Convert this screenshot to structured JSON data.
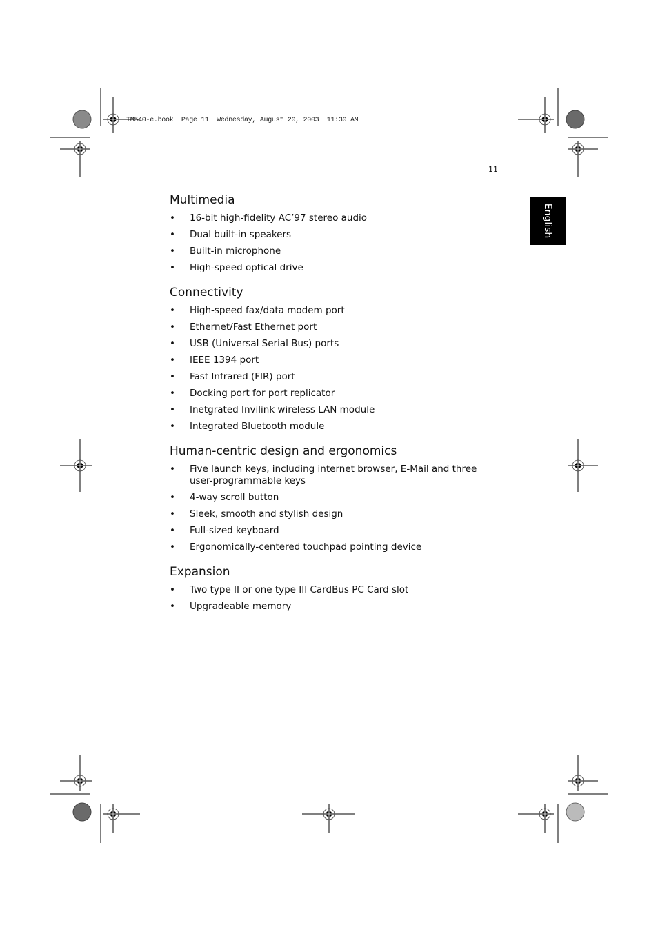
{
  "header": {
    "print_slug": "TM540-e.book  Page 11  Wednesday, August 20, 2003  11:30 AM"
  },
  "page_number": "11",
  "side_tab": {
    "label": "English",
    "background": "#000000",
    "text_color": "#ffffff"
  },
  "sections": [
    {
      "title": "Multimedia",
      "items": [
        "16-bit high-fidelity AC’97 stereo audio",
        "Dual built-in speakers",
        "Built-in microphone",
        "High-speed optical drive"
      ]
    },
    {
      "title": "Connectivity",
      "items": [
        "High-speed fax/data modem port",
        "Ethernet/Fast Ethernet port",
        "USB (Universal Serial Bus) ports",
        "IEEE 1394 port",
        "Fast Infrared (FIR) port",
        "Docking port for port replicator",
        "Inetgrated Invilink wireless LAN module",
        "Integrated Bluetooth module"
      ]
    },
    {
      "title": "Human-centric design and ergonomics",
      "items": [
        "Five launch keys, including internet browser, E-Mail and three user-programmable keys",
        "4-way scroll button",
        "Sleek, smooth and stylish design",
        "Full-sized keyboard",
        "Ergonomically-centered touchpad pointing device"
      ]
    },
    {
      "title": "Expansion",
      "items": [
        "Two type II or one type III CardBus PC Card slot",
        "Upgradeable memory"
      ]
    }
  ],
  "bullet_glyph": "•"
}
